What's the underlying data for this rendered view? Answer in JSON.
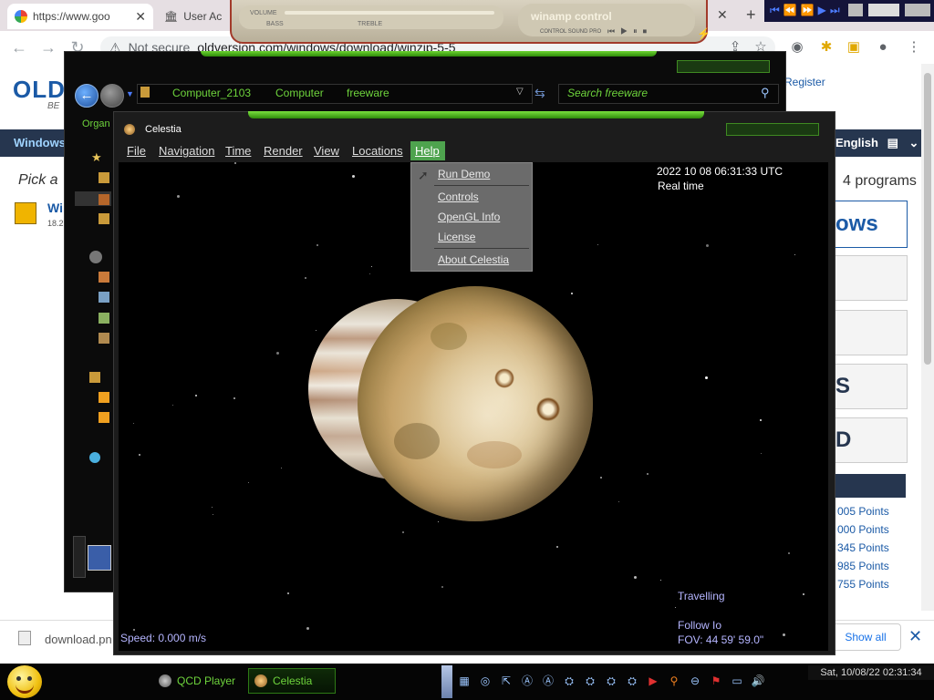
{
  "browser": {
    "tabs": [
      {
        "label": "https://www.goo"
      },
      {
        "label": "User Ac"
      }
    ],
    "address": {
      "security": "Not secure",
      "url": "oldversion.com/windows/download/winzip-5-5"
    }
  },
  "website": {
    "logo": "OLD",
    "logo_sub": "BE",
    "register": "Register",
    "nav_windows": "Windows",
    "nav_language": "English",
    "pick_text": "Pick a",
    "programs_text": "4 programs",
    "side_box_1": "ows",
    "side_box_2": "S",
    "side_box_3": "D",
    "points": [
      "005 Points",
      "000 Points",
      "345 Points",
      "985 Points",
      "755 Points"
    ],
    "item_title": "Wi",
    "item_sub": "18.2"
  },
  "download_bar": {
    "file": "download.pn",
    "show_all": "Show all"
  },
  "winamp": {
    "title": "winamp control",
    "sub": "CONTROL SOUND PRO",
    "vol": "VOLUME",
    "bass": "BASS",
    "treble": "TREBLE"
  },
  "explorer": {
    "breadcrumbs": [
      "Computer_2103",
      "Computer",
      "freeware"
    ],
    "search_placeholder": "Search freeware",
    "organize": "Organ"
  },
  "celestia": {
    "title": "Celestia",
    "menu": [
      "File",
      "Navigation",
      "Time",
      "Render",
      "View",
      "Locations",
      "Help"
    ],
    "help_menu": [
      "Run Demo",
      "Controls",
      "OpenGL Info",
      "License",
      "About Celestia"
    ],
    "datetime": "2022 10 08 06:31:33 UTC",
    "time_mode": "Real time",
    "status": "Travelling",
    "follow": "Follow Io",
    "fov": "FOV: 44 59' 59.0\"",
    "speed": "Speed: 0.000 m/s"
  },
  "taskbar": {
    "buttons": [
      "QCD Player",
      "Celestia"
    ],
    "clock": "Sat, 10/08/22 02:31:34",
    "tray_icons": [
      "window-icon",
      "disc-icon",
      "shortcut-icon",
      "ac-icon",
      "ac-icon",
      "network-icon",
      "network-icon",
      "network-icon",
      "network-icon",
      "play-icon",
      "search-icon",
      "minus-icon",
      "flag-icon",
      "monitor-icon",
      "volume-icon"
    ]
  }
}
